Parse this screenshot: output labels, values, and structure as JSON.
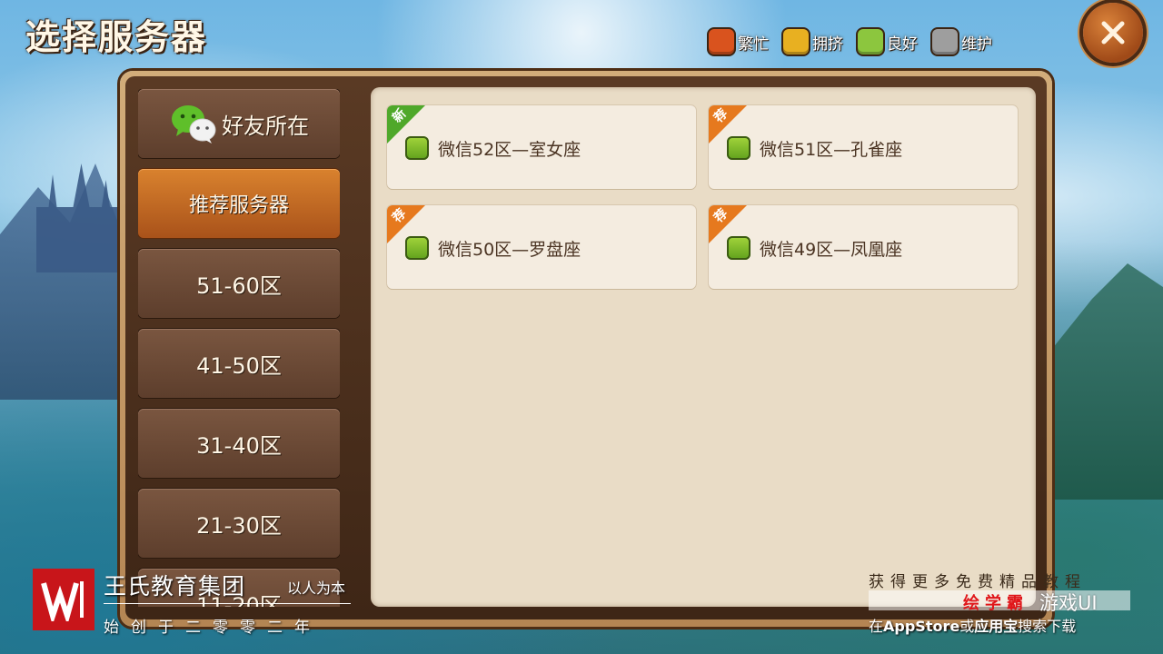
{
  "title": "选择服务器",
  "legend": [
    {
      "label": "繁忙",
      "color": "#d9531e"
    },
    {
      "label": "拥挤",
      "color": "#e8b021"
    },
    {
      "label": "良好",
      "color": "#8cc63e"
    },
    {
      "label": "维护",
      "color": "#9e9e9e"
    }
  ],
  "close_icon": "close-icon",
  "sidebar": {
    "items": [
      {
        "label": "好友所在",
        "icon": "wechat-icon"
      },
      {
        "label": "推荐服务器",
        "active": true
      },
      {
        "label": "51-60区"
      },
      {
        "label": "41-50区"
      },
      {
        "label": "31-40区"
      },
      {
        "label": "21-30区"
      },
      {
        "label": "11-20区"
      }
    ]
  },
  "servers": [
    {
      "name": "微信52区—室女座",
      "tag": "新",
      "tag_color": "#4fa82a",
      "status": "良好"
    },
    {
      "name": "微信51区—孔雀座",
      "tag": "荐",
      "tag_color": "#e6791e",
      "status": "良好"
    },
    {
      "name": "微信50区—罗盘座",
      "tag": "荐",
      "tag_color": "#e6791e",
      "status": "良好"
    },
    {
      "name": "微信49区—凤凰座",
      "tag": "荐",
      "tag_color": "#e6791e",
      "status": "良好"
    }
  ],
  "watermark_left": {
    "title": "王氏教育集团",
    "slogan": "以人为本",
    "founded": "始创于二零零二年"
  },
  "watermark_right": {
    "line1": "获得更多免费精品教程",
    "brand": "绘学霸",
    "game_ui": "游戏UI",
    "line3_prefix": "在",
    "line3_app": "AppStore",
    "line3_or": "或",
    "line3_store": "应用宝",
    "line3_suffix": "搜索下载"
  }
}
